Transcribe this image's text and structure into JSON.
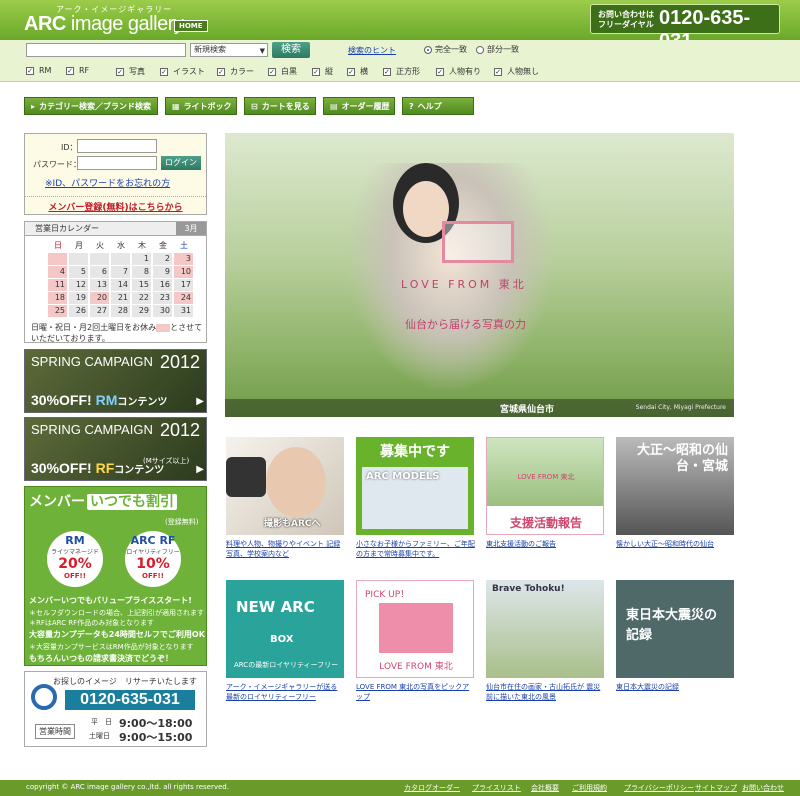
{
  "header": {
    "logo_kana": "アーク・イメージギャラリー",
    "logo_main": "ARC",
    "logo_rest": " image gallery",
    "home": "HOME",
    "phone_label": "お問い合わせはフリーダイヤル",
    "phone": "0120-635-031"
  },
  "search": {
    "select": "新規検索",
    "button": "検索",
    "hint": "検索のヒント",
    "exact": "完全一致",
    "partial": "部分一致",
    "filters": [
      "RM",
      "RF",
      "写真",
      "イラスト",
      "カラー",
      "白黒",
      "縦",
      "横",
      "正方形",
      "人物有り",
      "人物無し"
    ]
  },
  "nav": {
    "category": "カテゴリー検索／ブランド検索",
    "lightbox": "ライトボックス",
    "cart": "カートを見る",
    "orders": "オーダー履歴",
    "help": "ヘルプ"
  },
  "login": {
    "id_label": "ID：",
    "pw_label": "パスワード：",
    "button": "ログイン",
    "forgot": "※ID、パスワードをお忘れの方",
    "register": "メンバー登録(無料)はこちらから"
  },
  "calendar": {
    "title": "営業日カレンダー",
    "month": "3月",
    "weekdays": [
      "日",
      "月",
      "火",
      "水",
      "木",
      "金",
      "土"
    ],
    "days": [
      "1",
      "2",
      "3",
      "4",
      "5",
      "6",
      "7",
      "8",
      "9",
      "10",
      "11",
      "12",
      "13",
      "14",
      "15",
      "16",
      "17",
      "18",
      "19",
      "20",
      "21",
      "22",
      "23",
      "24",
      "25",
      "26",
      "27",
      "28",
      "29",
      "30",
      "31"
    ],
    "note_a": "日曜・祝日・月2回土曜日をお休み",
    "note_b": "とさせていただいております。"
  },
  "banners": {
    "campaign": "SPRING CAMPAIGN",
    "year": "2012",
    "rm_off": "30%OFF!",
    "rm_code": "RM",
    "rm_suffix": "コンテンツ",
    "rf_off": "30%OFF!",
    "rf_code": "RF",
    "rf_suffix": "コンテンツ",
    "rf_note": "(Mサイズ以上)"
  },
  "member": {
    "title": "メンバー",
    "title_badge": "いつでも割引",
    "note": "(登録無料)",
    "rm_code": "RM",
    "rm_type": "ライツマネージド",
    "rm_pct": "20%",
    "rm_off": "OFF!!",
    "rf_code": "ARC RF",
    "rf_type": "ロイヤリティフリー",
    "rf_pct": "10%",
    "rf_off": "OFF!!",
    "line1": "メンバーいつでもバリュープライススタート!",
    "line2": "＊セルフダウンロードの場合、上記割引が適用されます",
    "line3": "＊RFはARC RF作品のみ対象となります",
    "line4": "大容量カンプデータも24時間セルフでご利用OK",
    "line5": "＊大容量カンプサービスはRM作品が対象となります",
    "line6": "もちろんいつもの請求書決済でどうぞ！"
  },
  "contact": {
    "heading": "お探しのイメージ　リサーチいたします",
    "phone": "0120-635-031",
    "hours_label": "営業時間",
    "weekday": "平　日",
    "weekday_hours": "9:00～18:00",
    "saturday": "土曜日",
    "saturday_hours": "9:00～15:00"
  },
  "hero": {
    "logo": "LOVE FROM 東北",
    "tagline": "仙台から届ける写真の力",
    "location": "宮城県仙台市",
    "location_en": "Sendai City, Miyagi Prefecture"
  },
  "tiles": [
    {
      "label": "撮影もARCへ",
      "caption": "料理や人物、物撮りやイベント 記録写真、学校案内など"
    },
    {
      "label": "募集中です",
      "sub": "ARC MODELS",
      "caption": "小さなお子様からファミリー、ご年配の方まで常時募集中です。"
    },
    {
      "label": "支援活動報告",
      "sub": "LOVE FROM 東北",
      "caption": "東北支援活動のご報告"
    },
    {
      "label": "大正～昭和の仙台・宮城",
      "caption": "懐かしい大正～昭和時代の仙台"
    },
    {
      "label": "NEW ARC",
      "sub": "BOX",
      "extra": "ARCの最新ロイヤリティーフリー",
      "caption": "アーク・イメージギャラリーが送る 最新のロイヤリティーフリー"
    },
    {
      "label": "PICK UP！",
      "sub": "LOVE FROM 東北",
      "caption": "LOVE FROM 東北の写真をピックアップ"
    },
    {
      "label": "Brave Tohoku!",
      "caption": "仙台市在住の画家・古山拓氏が 震災前に描いた東北の風景"
    },
    {
      "label": "東日本大震災の記録",
      "caption": "東日本大震災の記録"
    }
  ],
  "footer": {
    "copyright": "copyright © ARC image gallery co.,ltd.  all rights reserved.",
    "links": [
      "カタログオーダー",
      "プライスリスト",
      "会社概要",
      "ご利用規約",
      "プライバシーポリシー",
      "サイトマップ",
      "お問い合わせ"
    ]
  }
}
